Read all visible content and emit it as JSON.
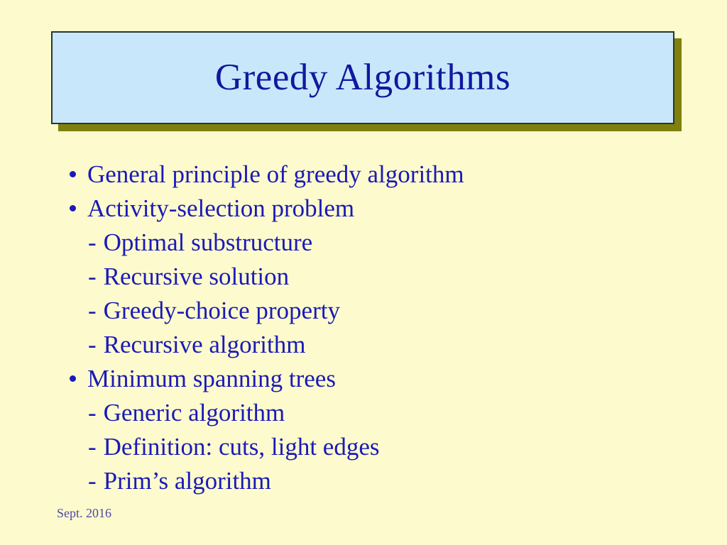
{
  "slide": {
    "background_color": "#fdfbcd",
    "title": "Greedy Algorithms",
    "title_box": {
      "fill_color": "#c9e7fb",
      "border_color": "#29372c",
      "shadow_color": "#80800d"
    },
    "title_color": "#12189e",
    "body_color": "#1a1ab8",
    "footer_color": "#5146a8"
  },
  "content": {
    "items": [
      {
        "level": 1,
        "marker": "bullet",
        "text": "General principle of greedy algorithm"
      },
      {
        "level": 1,
        "marker": "bullet",
        "text": "Activity-selection problem"
      },
      {
        "level": 2,
        "marker": "dash",
        "text": "Optimal substructure"
      },
      {
        "level": 2,
        "marker": "dash",
        "text": "Recursive solution"
      },
      {
        "level": 2,
        "marker": "dash",
        "text": "Greedy-choice property"
      },
      {
        "level": 2,
        "marker": "dash",
        "text": "Recursive algorithm"
      },
      {
        "level": 1,
        "marker": "bullet",
        "text": "Minimum spanning trees"
      },
      {
        "level": 2,
        "marker": "dash",
        "text": "Generic algorithm"
      },
      {
        "level": 2,
        "marker": "dash",
        "text": "Definition: cuts, light edges"
      },
      {
        "level": 2,
        "marker": "dash",
        "text": "Prim’s algorithm"
      }
    ],
    "dash_glyph": "-"
  },
  "footer": {
    "date": "Sept. 2016"
  }
}
